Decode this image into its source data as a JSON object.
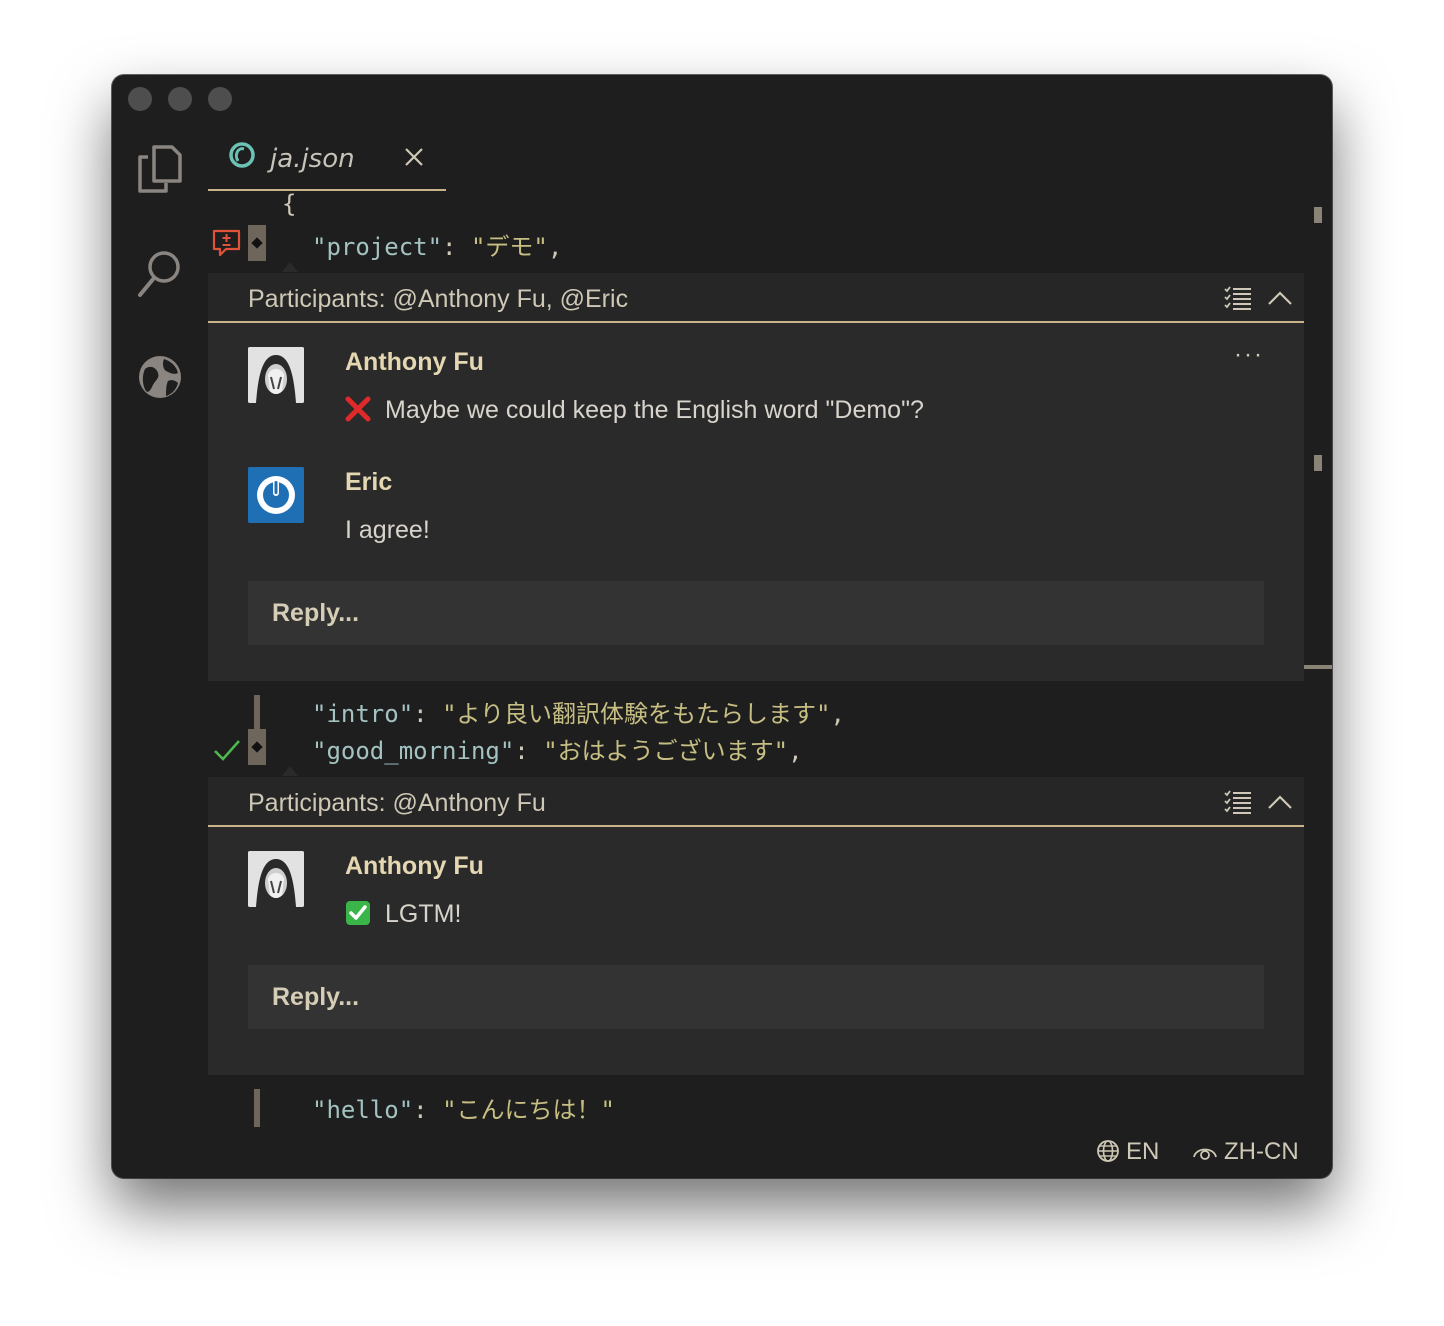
{
  "tab": {
    "filename": "ja.json"
  },
  "code": {
    "open_brace": "{",
    "line_project": {
      "key": "\"project\"",
      "sep": ": ",
      "value": "\"デモ\"",
      "end": ","
    },
    "line_intro": {
      "key": "\"intro\"",
      "sep": ": ",
      "value": "\"より良い翻訳体験をもたらします\"",
      "end": ","
    },
    "line_good_morning": {
      "key": "\"good_morning\"",
      "sep": ": ",
      "value": "\"おはようございます\"",
      "end": ","
    },
    "line_hello": {
      "key": "\"hello\"",
      "sep": ": ",
      "value": "\"こんにちは！\"",
      "end": ""
    }
  },
  "thread1": {
    "participants": "Participants: @Anthony Fu, @Eric",
    "comments": [
      {
        "author": "Anthony Fu",
        "reaction_icon": "cross-mark-icon",
        "text": "Maybe we could keep the English word \"Demo\"?"
      },
      {
        "author": "Eric",
        "text": "I agree!"
      }
    ],
    "more_actions": "···",
    "reply_placeholder": "Reply..."
  },
  "thread2": {
    "participants": "Participants: @Anthony Fu",
    "comments": [
      {
        "author": "Anthony Fu",
        "reaction_icon": "check-mark-icon",
        "text": "LGTM!"
      }
    ],
    "reply_placeholder": "Reply..."
  },
  "status_bar": {
    "source_locale": "EN",
    "display_locale": "ZH-CN"
  },
  "colors": {
    "accent": "#c9b48a",
    "background": "#1e1e1e",
    "thread_bg": "#2a2a2a",
    "error": "#e0533a",
    "success": "#4fb84f"
  }
}
